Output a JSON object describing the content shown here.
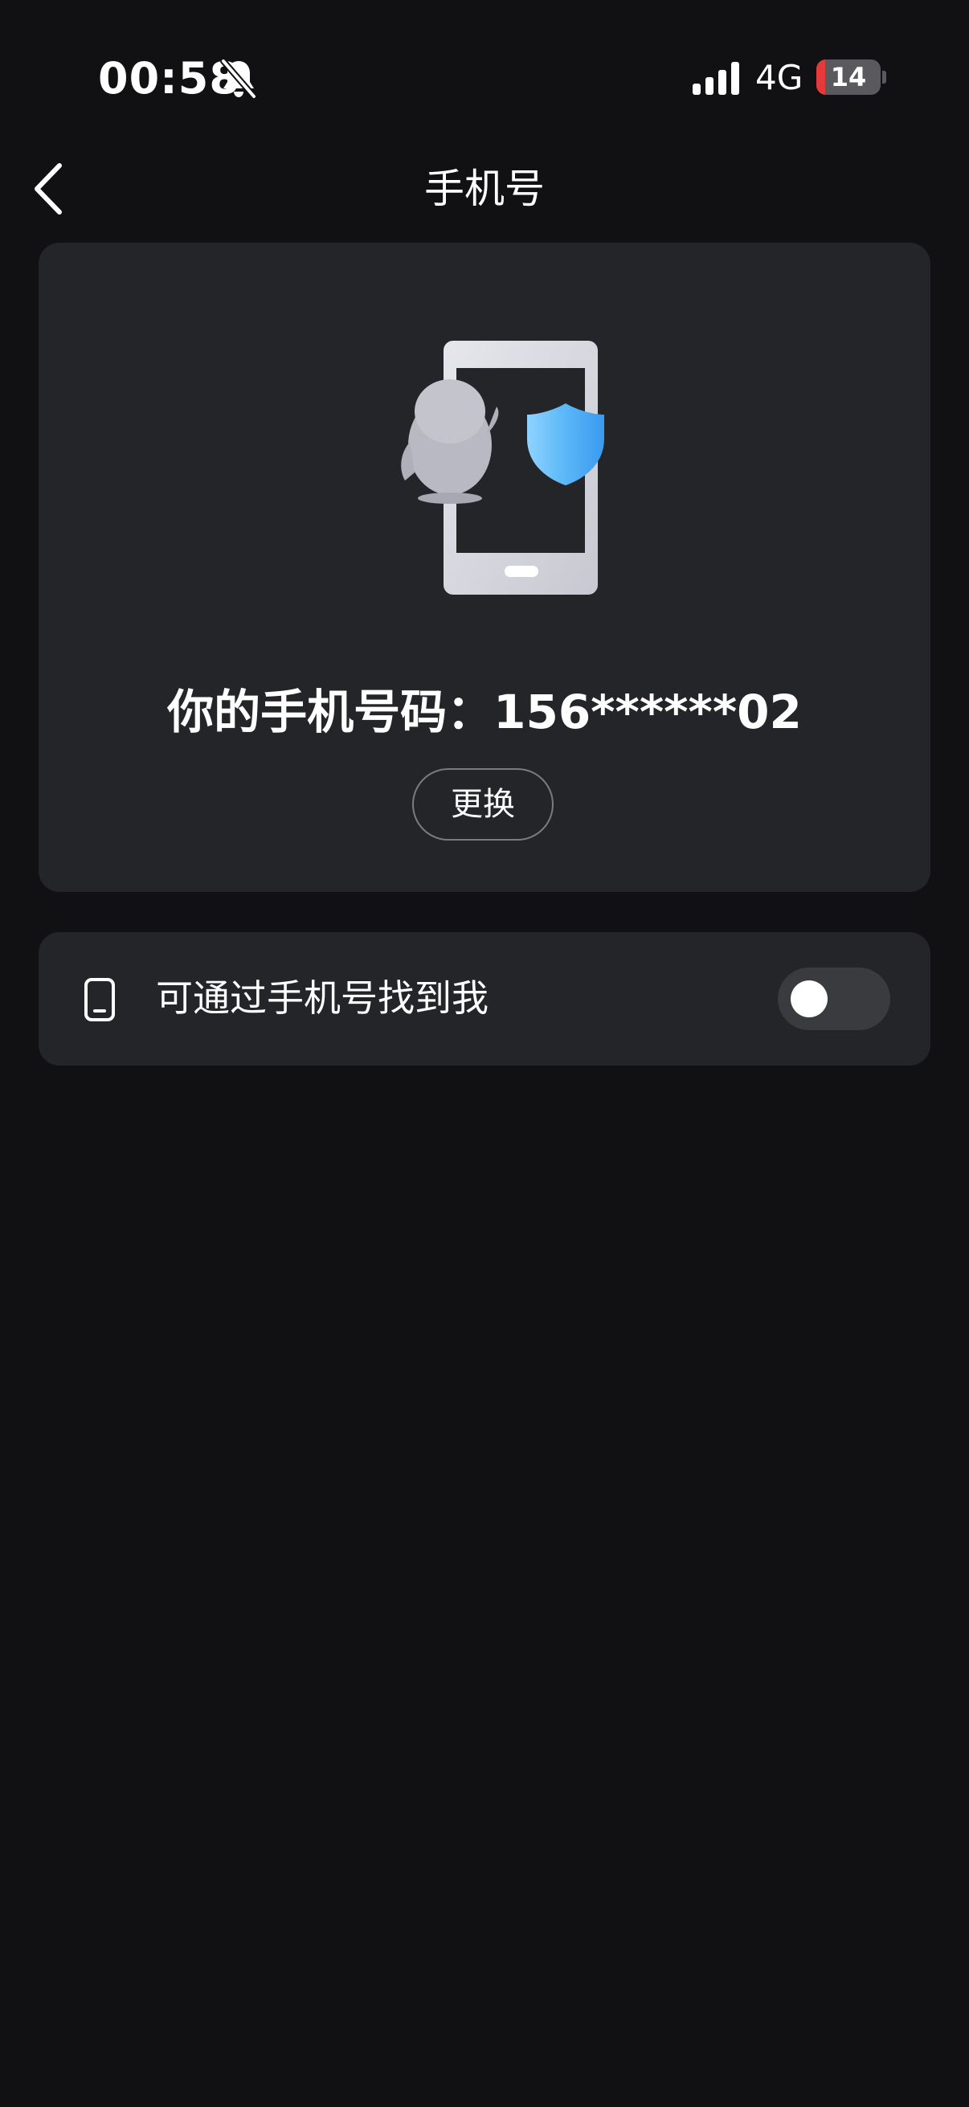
{
  "status_bar": {
    "time": "00:58",
    "network": "4G",
    "battery_level": "14",
    "battery_fraction": 0.14,
    "icons": [
      "bell-slash-icon",
      "cellular-signal-icon",
      "battery-icon"
    ]
  },
  "nav": {
    "back_icon": "chevron-left-icon",
    "title": "手机号"
  },
  "phone_card": {
    "illustration_icons": [
      "phone-shield-illustration",
      "penguin-icon",
      "shield-icon"
    ],
    "number_text": "你的手机号码：156******02",
    "change_label": "更换"
  },
  "settings": {
    "discoverable_icon": "phone-icon",
    "discoverable_label": "可通过手机号找到我",
    "discoverable_enabled": false
  },
  "colors": {
    "background": "#111113",
    "card": "#242528",
    "accent_shield": "#4aa8f5",
    "battery_low": "#e5393a"
  }
}
